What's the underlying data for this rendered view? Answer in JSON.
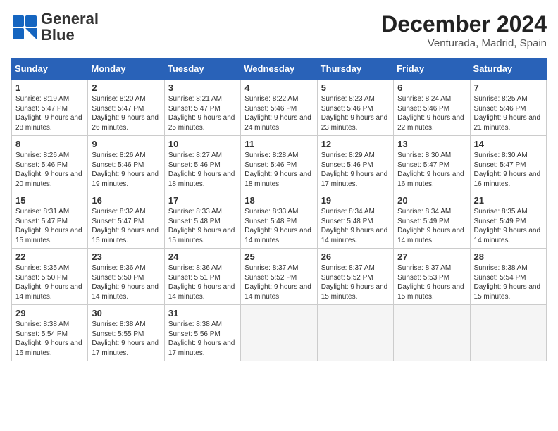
{
  "header": {
    "logo_general": "General",
    "logo_blue": "Blue",
    "title": "December 2024",
    "location": "Venturada, Madrid, Spain"
  },
  "days_of_week": [
    "Sunday",
    "Monday",
    "Tuesday",
    "Wednesday",
    "Thursday",
    "Friday",
    "Saturday"
  ],
  "weeks": [
    [
      {
        "day": "1",
        "sunrise": "8:19 AM",
        "sunset": "5:47 PM",
        "daylight": "9 hours and 28 minutes."
      },
      {
        "day": "2",
        "sunrise": "8:20 AM",
        "sunset": "5:47 PM",
        "daylight": "9 hours and 26 minutes."
      },
      {
        "day": "3",
        "sunrise": "8:21 AM",
        "sunset": "5:47 PM",
        "daylight": "9 hours and 25 minutes."
      },
      {
        "day": "4",
        "sunrise": "8:22 AM",
        "sunset": "5:46 PM",
        "daylight": "9 hours and 24 minutes."
      },
      {
        "day": "5",
        "sunrise": "8:23 AM",
        "sunset": "5:46 PM",
        "daylight": "9 hours and 23 minutes."
      },
      {
        "day": "6",
        "sunrise": "8:24 AM",
        "sunset": "5:46 PM",
        "daylight": "9 hours and 22 minutes."
      },
      {
        "day": "7",
        "sunrise": "8:25 AM",
        "sunset": "5:46 PM",
        "daylight": "9 hours and 21 minutes."
      }
    ],
    [
      {
        "day": "8",
        "sunrise": "8:26 AM",
        "sunset": "5:46 PM",
        "daylight": "9 hours and 20 minutes."
      },
      {
        "day": "9",
        "sunrise": "8:26 AM",
        "sunset": "5:46 PM",
        "daylight": "9 hours and 19 minutes."
      },
      {
        "day": "10",
        "sunrise": "8:27 AM",
        "sunset": "5:46 PM",
        "daylight": "9 hours and 18 minutes."
      },
      {
        "day": "11",
        "sunrise": "8:28 AM",
        "sunset": "5:46 PM",
        "daylight": "9 hours and 18 minutes."
      },
      {
        "day": "12",
        "sunrise": "8:29 AM",
        "sunset": "5:46 PM",
        "daylight": "9 hours and 17 minutes."
      },
      {
        "day": "13",
        "sunrise": "8:30 AM",
        "sunset": "5:47 PM",
        "daylight": "9 hours and 16 minutes."
      },
      {
        "day": "14",
        "sunrise": "8:30 AM",
        "sunset": "5:47 PM",
        "daylight": "9 hours and 16 minutes."
      }
    ],
    [
      {
        "day": "15",
        "sunrise": "8:31 AM",
        "sunset": "5:47 PM",
        "daylight": "9 hours and 15 minutes."
      },
      {
        "day": "16",
        "sunrise": "8:32 AM",
        "sunset": "5:47 PM",
        "daylight": "9 hours and 15 minutes."
      },
      {
        "day": "17",
        "sunrise": "8:33 AM",
        "sunset": "5:48 PM",
        "daylight": "9 hours and 15 minutes."
      },
      {
        "day": "18",
        "sunrise": "8:33 AM",
        "sunset": "5:48 PM",
        "daylight": "9 hours and 14 minutes."
      },
      {
        "day": "19",
        "sunrise": "8:34 AM",
        "sunset": "5:48 PM",
        "daylight": "9 hours and 14 minutes."
      },
      {
        "day": "20",
        "sunrise": "8:34 AM",
        "sunset": "5:49 PM",
        "daylight": "9 hours and 14 minutes."
      },
      {
        "day": "21",
        "sunrise": "8:35 AM",
        "sunset": "5:49 PM",
        "daylight": "9 hours and 14 minutes."
      }
    ],
    [
      {
        "day": "22",
        "sunrise": "8:35 AM",
        "sunset": "5:50 PM",
        "daylight": "9 hours and 14 minutes."
      },
      {
        "day": "23",
        "sunrise": "8:36 AM",
        "sunset": "5:50 PM",
        "daylight": "9 hours and 14 minutes."
      },
      {
        "day": "24",
        "sunrise": "8:36 AM",
        "sunset": "5:51 PM",
        "daylight": "9 hours and 14 minutes."
      },
      {
        "day": "25",
        "sunrise": "8:37 AM",
        "sunset": "5:52 PM",
        "daylight": "9 hours and 14 minutes."
      },
      {
        "day": "26",
        "sunrise": "8:37 AM",
        "sunset": "5:52 PM",
        "daylight": "9 hours and 15 minutes."
      },
      {
        "day": "27",
        "sunrise": "8:37 AM",
        "sunset": "5:53 PM",
        "daylight": "9 hours and 15 minutes."
      },
      {
        "day": "28",
        "sunrise": "8:38 AM",
        "sunset": "5:54 PM",
        "daylight": "9 hours and 15 minutes."
      }
    ],
    [
      {
        "day": "29",
        "sunrise": "8:38 AM",
        "sunset": "5:54 PM",
        "daylight": "9 hours and 16 minutes."
      },
      {
        "day": "30",
        "sunrise": "8:38 AM",
        "sunset": "5:55 PM",
        "daylight": "9 hours and 17 minutes."
      },
      {
        "day": "31",
        "sunrise": "8:38 AM",
        "sunset": "5:56 PM",
        "daylight": "9 hours and 17 minutes."
      },
      null,
      null,
      null,
      null
    ]
  ]
}
